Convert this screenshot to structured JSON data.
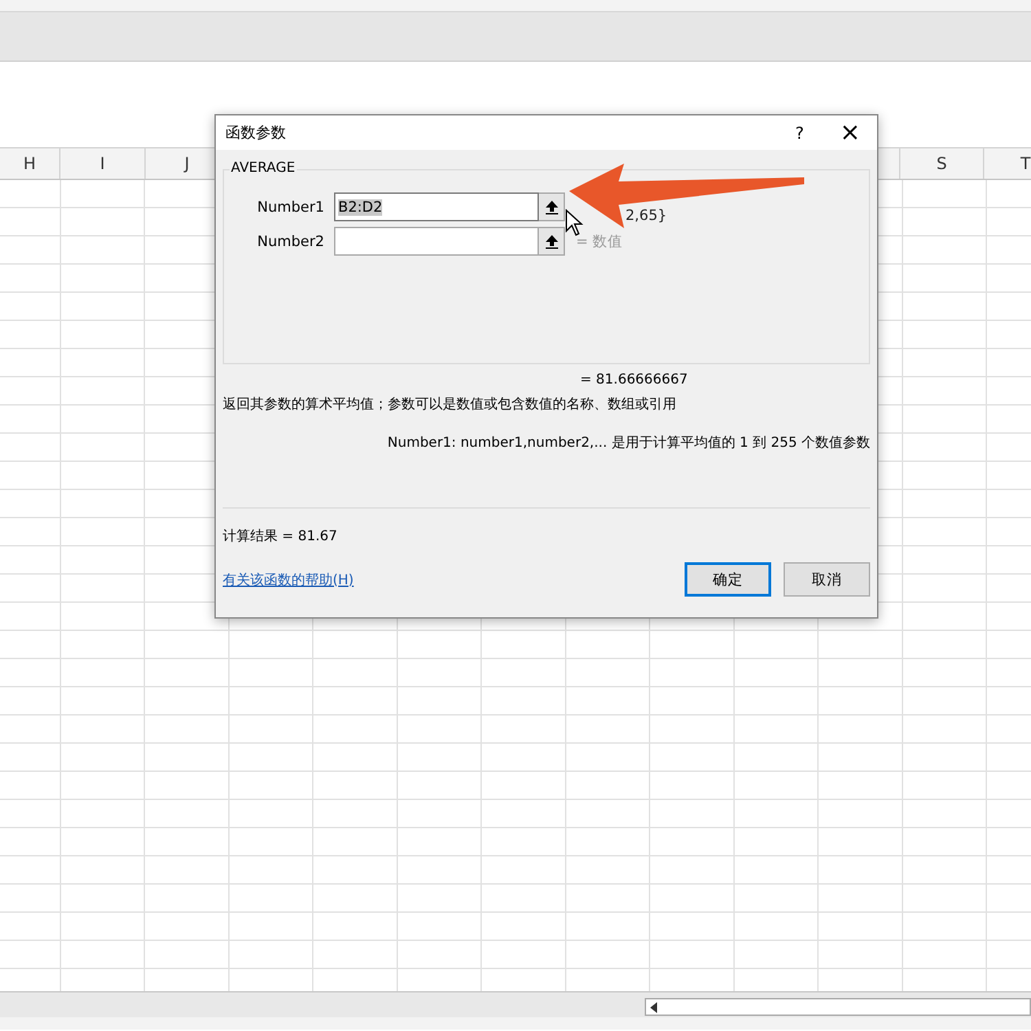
{
  "sheet": {
    "column_headers": [
      {
        "label": "H"
      },
      {
        "label": "I"
      },
      {
        "label": "J"
      },
      {
        "label": "S"
      },
      {
        "label": "T"
      }
    ]
  },
  "dialog": {
    "title": "函数参数",
    "help_button": "?",
    "close_button": "×",
    "function_name": "AVERAGE",
    "arguments": [
      {
        "label": "Number1",
        "value": "B2:D2",
        "selected": true,
        "result": "2,65}"
      },
      {
        "label": "Number2",
        "selected": false,
        "result": "=  数值"
      }
    ],
    "formula_result": "=   81.66666667",
    "description": "返回其参数的算术平均值；参数可以是数值或包含数值的名称、数组或引用",
    "argument_help": "Number1:  number1,number2,... 是用于计算平均值的 1 到 255 个数值参数",
    "calc_result": "计算结果 =   81.67",
    "help_link": "有关该函数的帮助(H)",
    "buttons": [
      {
        "label": "确定",
        "selected": true
      },
      {
        "label": "取消",
        "selected": false
      }
    ]
  }
}
